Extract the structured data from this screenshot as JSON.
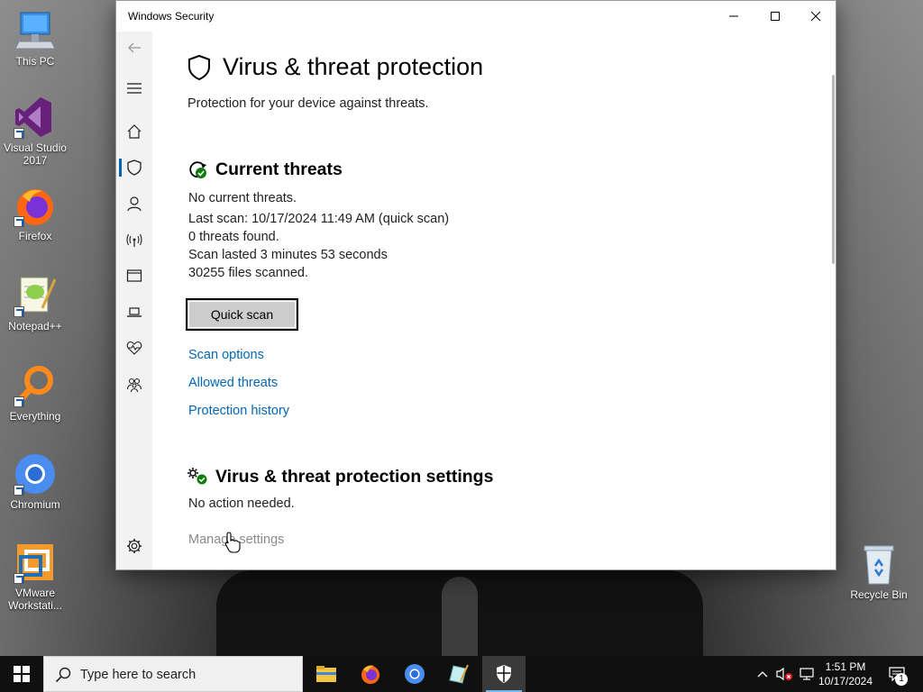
{
  "desktop": {
    "icons": [
      {
        "label": "This PC",
        "icon": "computer-icon"
      },
      {
        "label": "Visual Studio 2017",
        "icon": "visual-studio-icon"
      },
      {
        "label": "Firefox",
        "icon": "firefox-icon"
      },
      {
        "label": "Notepad++",
        "icon": "notepadpp-icon"
      },
      {
        "label": "Everything",
        "icon": "everything-search-icon"
      },
      {
        "label": "Chromium",
        "icon": "chromium-icon"
      },
      {
        "label": "VMware Workstati...",
        "icon": "vmware-icon"
      },
      {
        "label": "Recycle Bin",
        "icon": "recycle-bin-icon"
      }
    ]
  },
  "window": {
    "title": "Windows Security",
    "controls": [
      "minimize",
      "maximize",
      "close"
    ]
  },
  "nav": {
    "back_icon": "back-arrow-icon",
    "menu_icon": "hamburger-icon",
    "items": [
      {
        "icon": "home-icon",
        "selected": false
      },
      {
        "icon": "shield-icon",
        "selected": true
      },
      {
        "icon": "person-icon",
        "selected": false
      },
      {
        "icon": "wireless-icon",
        "selected": false
      },
      {
        "icon": "app-browser-icon",
        "selected": false
      },
      {
        "icon": "laptop-icon",
        "selected": false
      },
      {
        "icon": "heart-pulse-icon",
        "selected": false
      },
      {
        "icon": "family-icon",
        "selected": false
      }
    ],
    "settings_icon": "gear-icon"
  },
  "page": {
    "title": "Virus & threat protection",
    "subtitle": "Protection for your device against threats."
  },
  "current_threats": {
    "title": "Current threats",
    "status": "No current threats.",
    "last_scan": "Last scan: 10/17/2024 11:49 AM (quick scan)",
    "threats_found": "0 threats found.",
    "duration": "Scan lasted 3 minutes 53 seconds",
    "files_scanned": "30255 files scanned.",
    "quick_scan_label": "Quick scan",
    "links": [
      "Scan options",
      "Allowed threats",
      "Protection history"
    ]
  },
  "settings_section": {
    "title": "Virus & threat protection settings",
    "status": "No action needed.",
    "manage_link": "Manage settings"
  },
  "taskbar": {
    "search_placeholder": "Type here to search",
    "apps": [
      "file-explorer-icon",
      "firefox-icon",
      "chromium-icon",
      "notepadpp-icon",
      "windows-security-icon"
    ],
    "clock_time": "1:51 PM",
    "clock_date": "10/17/2024",
    "notification_count": "1"
  },
  "colors": {
    "accent": "#0063b1",
    "link": "#0067b8",
    "status_ok": "#107c10",
    "taskbar": "#101010"
  }
}
